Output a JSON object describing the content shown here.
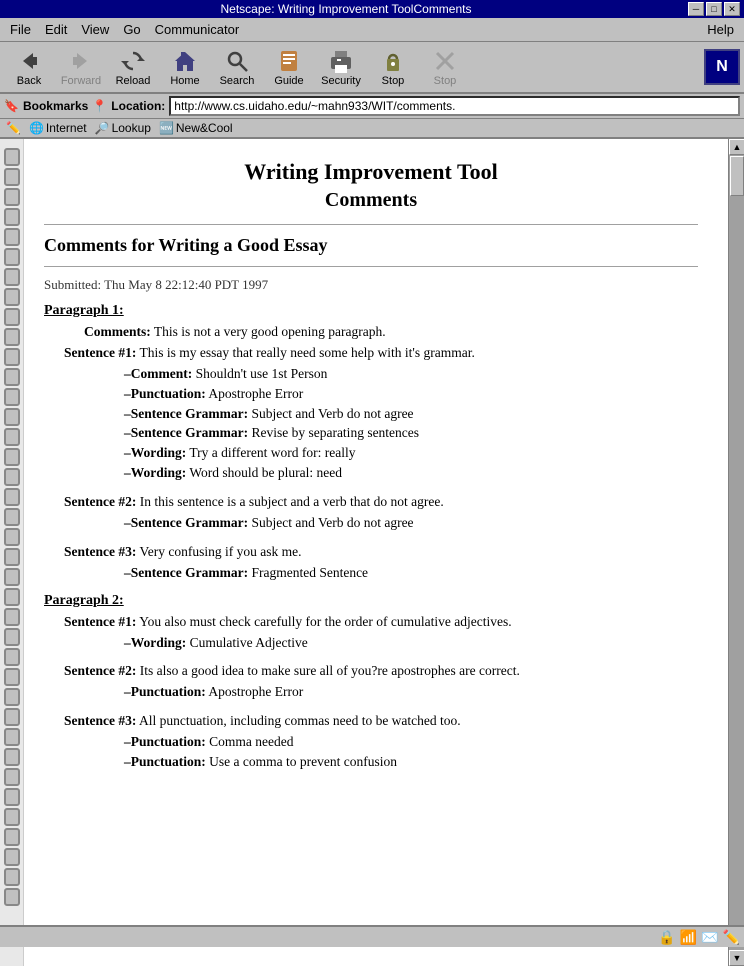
{
  "titleBar": {
    "text": "Netscape: Writing Improvement ToolComments",
    "controls": [
      "─",
      "□",
      "✕"
    ]
  },
  "menuBar": {
    "items": [
      "File",
      "Edit",
      "View",
      "Go",
      "Communicator"
    ],
    "help": "Help"
  },
  "toolbar": {
    "buttons": [
      {
        "id": "back",
        "label": "Back",
        "icon": "◀",
        "disabled": false
      },
      {
        "id": "forward",
        "label": "Forward",
        "icon": "▶",
        "disabled": true
      },
      {
        "id": "reload",
        "label": "Reload",
        "icon": "↻",
        "disabled": false
      },
      {
        "id": "home",
        "label": "Home",
        "icon": "🏠",
        "disabled": false
      },
      {
        "id": "search",
        "label": "Search",
        "icon": "🔍",
        "disabled": false
      },
      {
        "id": "guide",
        "label": "Guide",
        "icon": "📖",
        "disabled": false
      },
      {
        "id": "print",
        "label": "Print",
        "icon": "🖨",
        "disabled": false
      },
      {
        "id": "security",
        "label": "Security",
        "icon": "🔒",
        "disabled": false
      },
      {
        "id": "stop",
        "label": "Stop",
        "icon": "✖",
        "disabled": true
      }
    ],
    "logo": "N"
  },
  "locationBar": {
    "bookmarks_label": "Bookmarks",
    "location_label": "Location:",
    "url": "http://www.cs.uidaho.edu/~mahn933/WIT/comments."
  },
  "personalBar": {
    "items": [
      "Internet",
      "Lookup",
      "New&Cool"
    ]
  },
  "page": {
    "title": "Writing Improvement Tool",
    "subtitle": "Comments",
    "sectionTitle": "Comments for Writing a Good Essay",
    "submitted": "Submitted: Thu May 8 22:12:40 PDT 1997",
    "paragraphs": [
      {
        "heading": "Paragraph 1:",
        "comments": [
          {
            "label": "Comments:",
            "text": " This is not a very good opening paragraph."
          }
        ],
        "sentences": [
          {
            "label": "Sentence #1:",
            "text": " This is my essay that really need some help with it's grammar.",
            "subComments": [
              {
                "label": "–Comment:",
                "text": " Shouldn't use 1st Person"
              },
              {
                "label": "–Punctuation:",
                "text": " Apostrophe Error"
              },
              {
                "label": "–Sentence Grammar:",
                "text": " Subject and Verb do not agree"
              },
              {
                "label": "–Sentence Grammar:",
                "text": " Revise by separating sentences"
              },
              {
                "label": "–Wording:",
                "text": " Try a different word for: really"
              },
              {
                "label": "–Wording:",
                "text": " Word should be plural: need"
              }
            ]
          },
          {
            "label": "Sentence #2:",
            "text": " In this sentence is a subject and a verb that do not agree.",
            "subComments": [
              {
                "label": "–Sentence Grammar:",
                "text": " Subject and Verb do not agree"
              }
            ]
          },
          {
            "label": "Sentence #3:",
            "text": " Very confusing if you ask me.",
            "subComments": [
              {
                "label": "–Sentence Grammar:",
                "text": " Fragmented Sentence"
              }
            ]
          }
        ]
      },
      {
        "heading": "Paragraph 2:",
        "comments": [],
        "sentences": [
          {
            "label": "Sentence #1:",
            "text": " You also must check carefully for the order of cumulative adjectives.",
            "subComments": [
              {
                "label": "–Wording:",
                "text": " Cumulative Adjective"
              }
            ]
          },
          {
            "label": "Sentence #2:",
            "text": " Its also a good idea to make sure all of you?re apostrophes are correct.",
            "subComments": [
              {
                "label": "–Punctuation:",
                "text": " Apostrophe Error"
              }
            ]
          },
          {
            "label": "Sentence #3:",
            "text": " All punctuation, including commas need to be watched too.",
            "subComments": [
              {
                "label": "–Punctuation:",
                "text": " Comma needed"
              },
              {
                "label": "–Punctuation:",
                "text": " Use a comma to prevent confusion"
              }
            ]
          }
        ]
      }
    ]
  },
  "statusBar": {
    "text": ""
  },
  "spiralRings": 38
}
